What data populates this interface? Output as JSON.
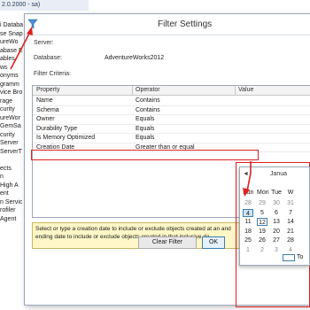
{
  "explorer": {
    "title": "2.0.2000 - sa)",
    "items": [
      "i Databa",
      "se Snap",
      "ureWo",
      "abase E",
      "ables",
      "ws",
      "onyms",
      "gramm",
      "vice Bro",
      "rage",
      "curity",
      "ureWor",
      "GemSa",
      "curity",
      "Server",
      "ServerT",
      "",
      "ects",
      "n",
      "High A",
      "ent",
      "n Servic",
      "rofiler",
      "Agent"
    ]
  },
  "dialog": {
    "title": "Filter Settings",
    "server_label": "Server:",
    "server_value": "",
    "database_label": "Database:",
    "database_value": "AdventureWorks2012",
    "criteria_label": "Filter Criteria:",
    "columns": [
      "Property",
      "Operator",
      "Value"
    ],
    "rows": [
      {
        "property": "Name",
        "operator": "Contains",
        "value": ""
      },
      {
        "property": "Schema",
        "operator": "Contains",
        "value": ""
      },
      {
        "property": "Owner",
        "operator": "Equals",
        "value": ""
      },
      {
        "property": "Durability Type",
        "operator": "Equals",
        "value": ""
      },
      {
        "property": "Is Memory Optimized",
        "operator": "Equals",
        "value": ""
      },
      {
        "property": "Creation Date",
        "operator": "Greater than or equal",
        "value": ""
      }
    ],
    "description": "Select or type a creation date to include or exclude objects created at an and ending date to include or exclude objects created in that inclusive da",
    "clear_filter_label": "Clear Filter",
    "ok_label": "OK"
  },
  "calendar": {
    "month_label": "Janua",
    "prev_arrow": "◄",
    "day_headers": [
      "Sun",
      "Mon",
      "Tue",
      "W"
    ],
    "weeks": [
      [
        "28",
        "29",
        "30",
        "31"
      ],
      [
        "4",
        "5",
        "6",
        "7"
      ],
      [
        "11",
        "12",
        "13",
        "14"
      ],
      [
        "18",
        "19",
        "20",
        "21"
      ],
      [
        "25",
        "26",
        "27",
        "28"
      ],
      [
        "1",
        "2",
        "3",
        "4"
      ]
    ],
    "selected_day": "4",
    "today_day": "12",
    "today_label": "To"
  },
  "colors": {
    "annotation": "#e02020",
    "selection": "#cce4f7",
    "accent": "#3c7fb1",
    "description_bg": "#fff7c8"
  }
}
